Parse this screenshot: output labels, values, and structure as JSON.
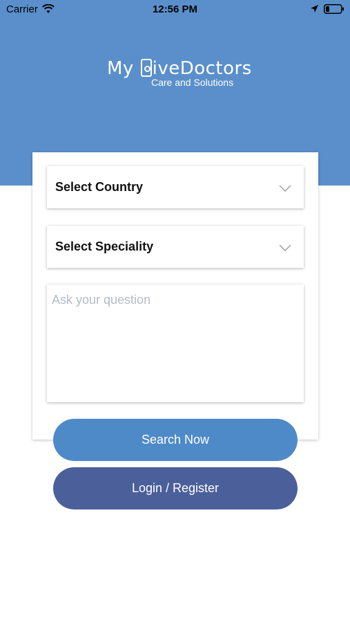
{
  "status_bar": {
    "carrier": "Carrier",
    "time": "12:56 PM",
    "icons": [
      "wifi-icon",
      "location-arrow-icon",
      "battery-icon"
    ]
  },
  "header": {
    "logo_text_left": "My ",
    "logo_text_right": "iveDoctors",
    "logo_tagline": "Care and Solutions",
    "background_color": "#5A8FCB"
  },
  "form": {
    "country_select": {
      "label": "Select Country",
      "icon": "chevron-down-icon"
    },
    "speciality_select": {
      "label": "Select Speciality",
      "icon": "chevron-down-icon"
    },
    "question_input": {
      "placeholder": "Ask your question",
      "value": ""
    }
  },
  "buttons": {
    "search_label": "Search Now",
    "login_label": "Login / Register",
    "search_color": "#4F8AC8",
    "login_color": "#4B5F9A"
  }
}
